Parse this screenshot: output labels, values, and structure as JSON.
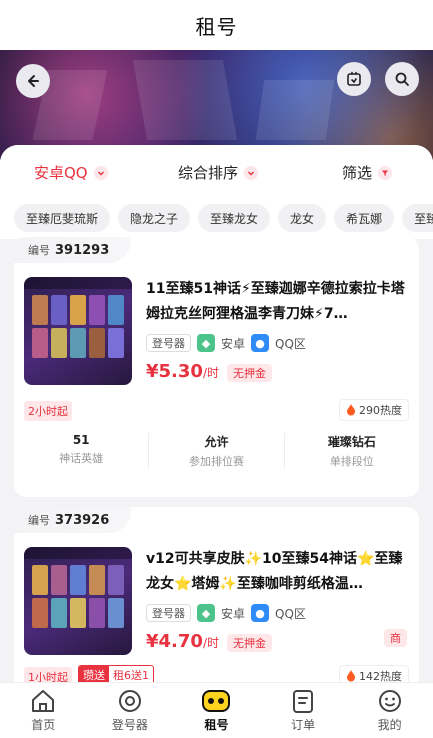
{
  "header": {
    "title": "租号"
  },
  "icons": {
    "back": "back-arrow-icon",
    "share": "share-icon",
    "search": "search-icon"
  },
  "filters": [
    {
      "label": "安卓QQ",
      "color": "#e8323f"
    },
    {
      "label": "综合排序",
      "color": "#222222"
    },
    {
      "label": "筛选",
      "color": "#222222"
    }
  ],
  "chips": [
    "至臻厄斐琉斯",
    "隐龙之子",
    "至臻龙女",
    "龙女",
    "希瓦娜",
    "至臻"
  ],
  "cards": [
    {
      "code_label": "编号",
      "code": "391293",
      "desc": "11至臻51神话⚡至臻迦娜辛德拉索拉卡塔姆拉克丝阿狸格温李青刀妹⚡7…",
      "source": "登号器",
      "os": "安卓",
      "zone": "QQ区",
      "price": "¥5.30",
      "unit": "/时",
      "deposit": "无押金",
      "min_rent": "2小时起",
      "hot": "290热度",
      "stats": [
        {
          "value": "51",
          "label": "神话英雄"
        },
        {
          "value": "允许",
          "label": "参加排位赛"
        },
        {
          "value": "璀璨钻石",
          "label": "单排段位"
        }
      ]
    },
    {
      "code_label": "编号",
      "code": "373926",
      "desc": "v12可共享皮肤✨10至臻54神话⭐至臻龙女⭐塔姆✨至臻咖啡剪纸格温…",
      "source": "登号器",
      "os": "安卓",
      "zone": "QQ区",
      "price": "¥4.70",
      "unit": "/时",
      "deposit": "无押金",
      "side_badge": "商",
      "min_rent": "1小时起",
      "promo_tag": "瓒送",
      "promo_text": "租6送1",
      "hot": "142热度"
    }
  ],
  "tabbar": [
    {
      "label": "首页",
      "icon": "home-icon",
      "active": false
    },
    {
      "label": "登号器",
      "icon": "login-tool-icon",
      "active": false
    },
    {
      "label": "租号",
      "icon": "gamepad-icon",
      "active": true
    },
    {
      "label": "订单",
      "icon": "order-icon",
      "active": false
    },
    {
      "label": "我的",
      "icon": "profile-icon",
      "active": false
    }
  ],
  "colors": {
    "accent": "#e8323f",
    "android": "#4cc38a",
    "qq": "#2f8bf5"
  }
}
